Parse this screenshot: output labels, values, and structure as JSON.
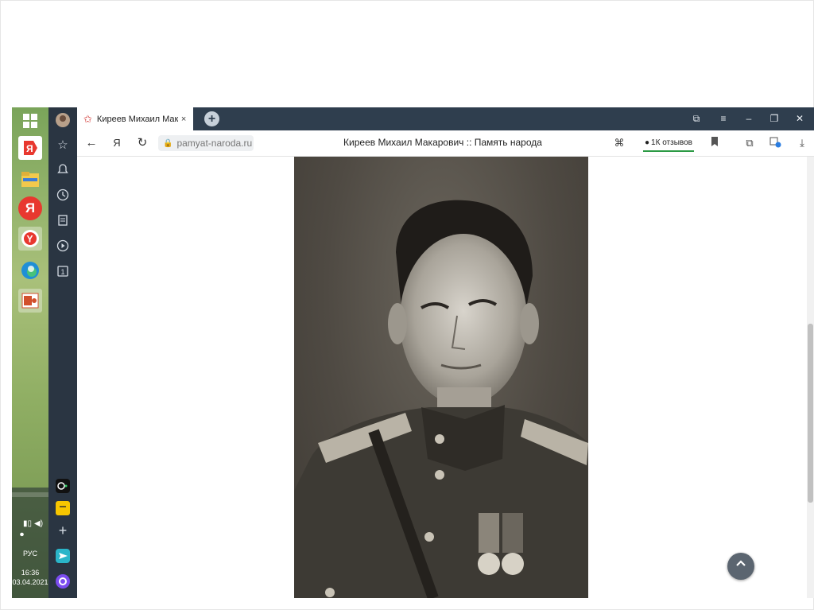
{
  "taskbar": {
    "tray_lang": "РУС",
    "tray_time": "16:36",
    "tray_date": "03.04.2021"
  },
  "tab": {
    "title": "Киреев Михаил Макар",
    "close": "×",
    "new_tab": "+"
  },
  "address_bar": {
    "url": "pamyat-naroda.ru",
    "page_title": "Киреев Михаил Макарович :: Память народа",
    "reviews": "1К отзывов"
  },
  "content": {
    "scroll_top_icon": "chevron-up-icon"
  },
  "colors": {
    "tabbar": "#2f3e4e",
    "sidebar": "#2a3542",
    "reviews_accent": "#2c9a45",
    "tab_star": "#d0312d"
  }
}
